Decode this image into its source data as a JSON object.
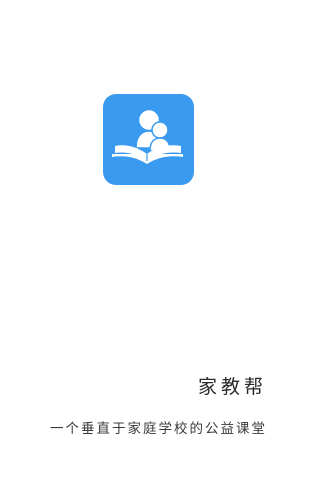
{
  "splash": {
    "icon": "family-reading-book-icon",
    "icon_color": "#3a9af0",
    "app_name": "家教帮",
    "slogan": "一个垂直于家庭学校的公益课堂"
  }
}
